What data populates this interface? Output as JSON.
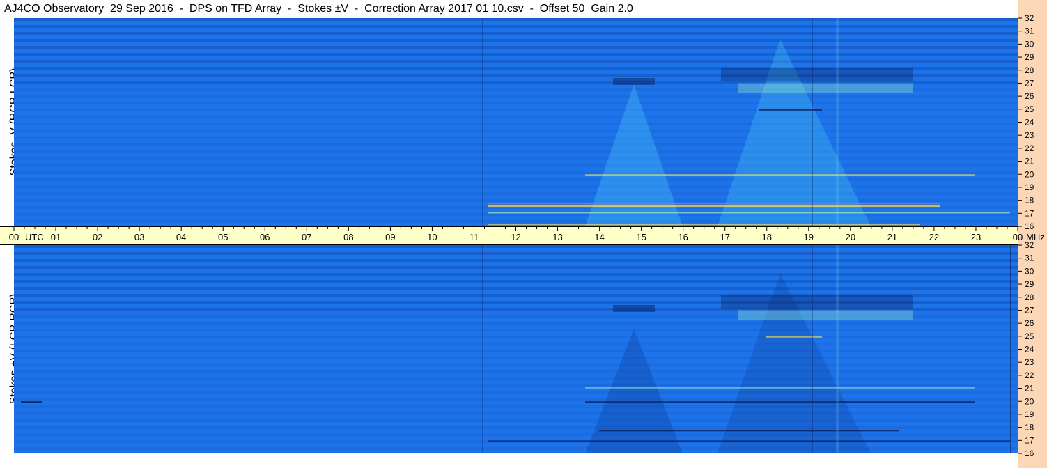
{
  "title": "AJ4CO Observatory  29 Sep 2016  -  DPS on TFD Array  -  Stokes ±V  -  Correction Array 2017 01 10.csv  -  Offset 50  Gain 2.0",
  "chart_data": [
    {
      "type": "heatmap",
      "ylabel": "Stokes -V (RCP-LCP)",
      "y_range_mhz": [
        16,
        32
      ],
      "x_range_utc_hours": [
        0,
        24
      ],
      "yticks": [
        "16",
        "17",
        "18",
        "19",
        "20",
        "21",
        "22",
        "23",
        "24",
        "25",
        "26",
        "27",
        "28",
        "29",
        "30",
        "31",
        "32"
      ]
    },
    {
      "type": "heatmap",
      "ylabel": "Stokes +V (LCP-RCP)",
      "y_range_mhz": [
        16,
        32
      ],
      "x_range_utc_hours": [
        0,
        24
      ],
      "yticks": [
        "16",
        "17",
        "18",
        "19",
        "20",
        "21",
        "22",
        "23",
        "24",
        "25",
        "26",
        "27",
        "28",
        "29",
        "30",
        "31",
        "32"
      ]
    }
  ],
  "time_axis": {
    "labels": [
      "00",
      "01",
      "02",
      "03",
      "04",
      "05",
      "06",
      "07",
      "08",
      "09",
      "10",
      "11",
      "12",
      "13",
      "14",
      "15",
      "16",
      "17",
      "18",
      "19",
      "20",
      "21",
      "22",
      "23",
      "00"
    ],
    "utc_label": "UTC",
    "mhz_label": "MHz"
  },
  "colors": {
    "background_blue": "#1a6fe8",
    "dark_band": "#0b3a9e",
    "axis_bg": "#ffffc8",
    "strip_bg": "#fbd7b6"
  }
}
